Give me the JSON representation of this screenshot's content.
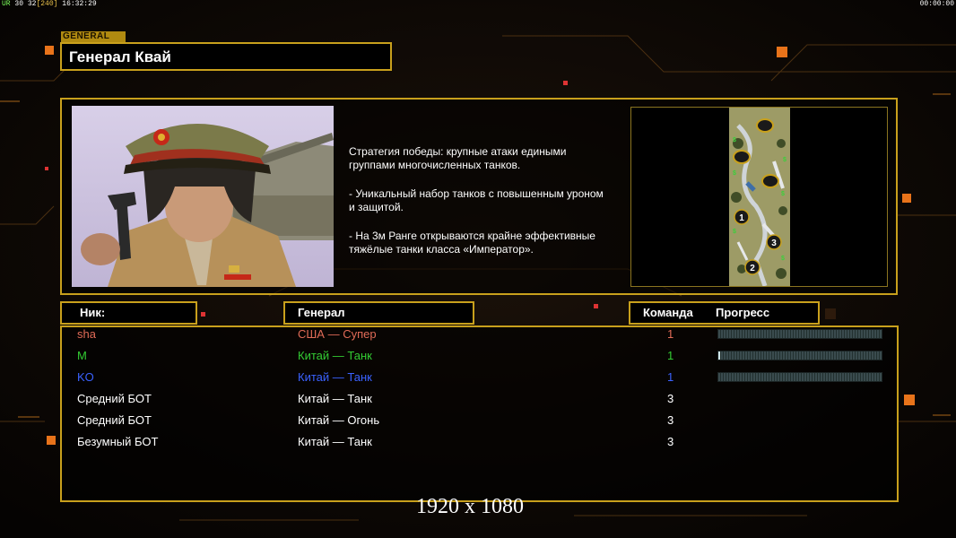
{
  "hud": {
    "left_prefix": "UR",
    "left_fps": "30 32",
    "left_bracket": "[240]",
    "left_time": "16:32:29",
    "right_time": "00:00:00"
  },
  "general": {
    "tag": "GENERAL",
    "name": "Генерал Квай",
    "description": [
      "Стратегия победы: крупные атаки едиными\n группами многочисленных танков.",
      "- Уникальный набор танков с повышенным уроном\n  и защитой.",
      "- На 3м Ранге открываются крайне эффективные\n  тяжёлые танки класса «Император»."
    ]
  },
  "minimap": {
    "slots": [
      "1",
      "2",
      "3"
    ]
  },
  "headers": {
    "nick": "Ник:",
    "general": "Генерал",
    "team": "Команда",
    "progress": "Прогресс"
  },
  "players": [
    {
      "nick": "sha",
      "faction": "США — Супер",
      "team": "1",
      "color": "#e06b57",
      "progress": 0.0,
      "show_progress": true
    },
    {
      "nick": "M",
      "faction": "Китай — Танк",
      "team": "1",
      "color": "#33cc33",
      "progress": 0.01,
      "show_progress": true
    },
    {
      "nick": "KO",
      "faction": "Китай — Танк",
      "team": "1",
      "color": "#3a62ff",
      "progress": 0.0,
      "show_progress": true
    },
    {
      "nick": "Средний БОТ",
      "faction": "Китай — Танк",
      "team": "3",
      "color": "#ffffff",
      "progress": null,
      "show_progress": false
    },
    {
      "nick": "Средний БОТ",
      "faction": "Китай — Огонь",
      "team": "3",
      "color": "#ffffff",
      "progress": null,
      "show_progress": false
    },
    {
      "nick": "Безумный БОТ",
      "faction": "Китай — Танк",
      "team": "3",
      "color": "#ffffff",
      "progress": null,
      "show_progress": false
    }
  ],
  "resolution_label": "1920 x 1080",
  "colors": {
    "accent": "#c8a01c",
    "background": "#070504"
  }
}
